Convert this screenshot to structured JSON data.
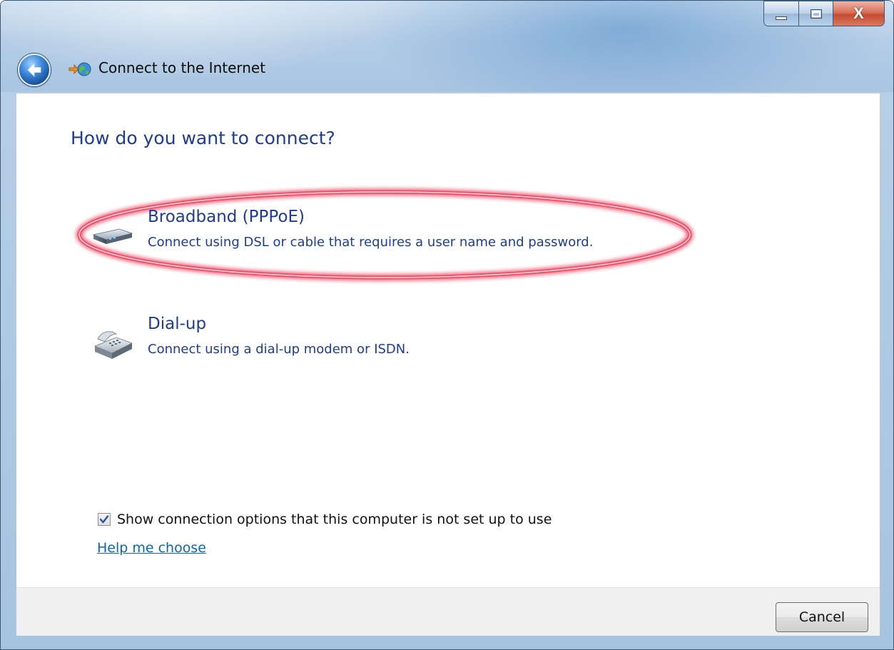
{
  "window": {
    "title": "Connect to the Internet",
    "caption_buttons": {
      "minimize": "minimize-icon",
      "maximize": "maximize-icon",
      "close": "X"
    }
  },
  "main": {
    "heading": "How do you want to connect?",
    "options": [
      {
        "title": "Broadband (PPPoE)",
        "description": "Connect using DSL or cable that requires a user name and password.",
        "icon": "broadband-modem-icon",
        "highlighted": true
      },
      {
        "title": "Dial-up",
        "description": "Connect using a dial-up modem or ISDN.",
        "icon": "telephone-modem-icon",
        "highlighted": false
      }
    ],
    "show_options_checkbox": {
      "label": "Show connection options that this computer is not set up to use",
      "checked": true
    },
    "help_link": "Help me choose"
  },
  "footer": {
    "cancel_label": "Cancel"
  },
  "colors": {
    "heading_blue": "#1e3c96",
    "link_blue": "#0b66b5",
    "highlight_ring": "#e8304f",
    "footer_bg": "#f0f0f0"
  }
}
